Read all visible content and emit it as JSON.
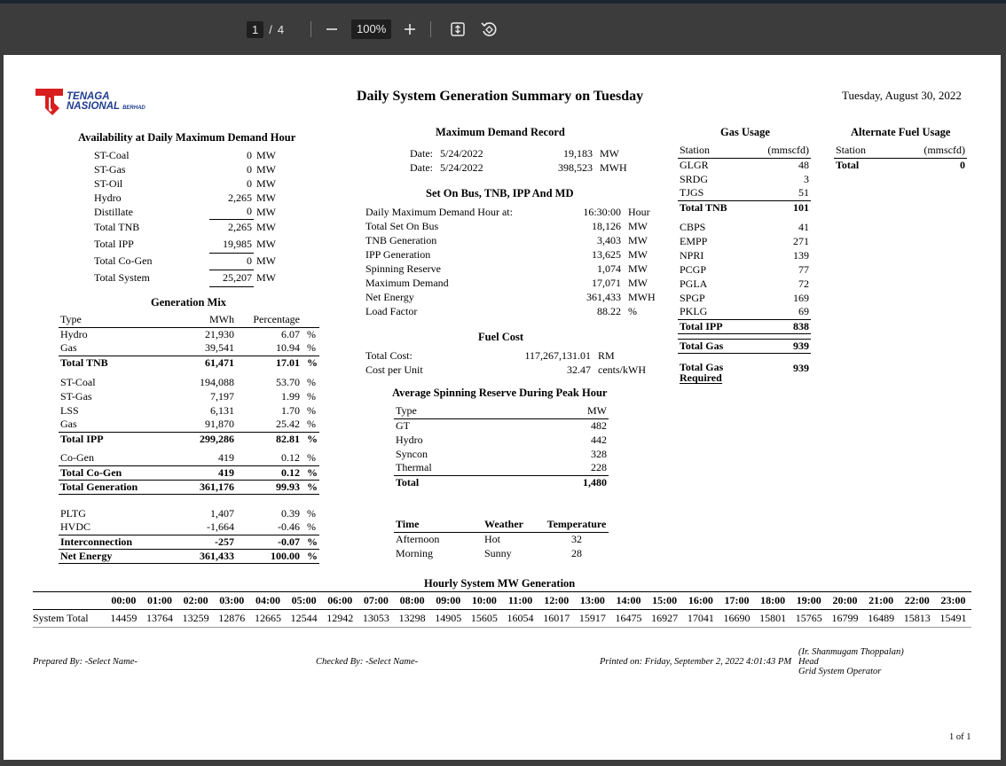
{
  "toolbar": {
    "current_page": "1",
    "page_sep": "/",
    "total_pages": "4",
    "zoom": "100%"
  },
  "header": {
    "logo_line1": "TENAGA",
    "logo_line2": "NASIONAL",
    "logo_line3": "BERHAD",
    "title": "Daily System Generation Summary on Tuesday",
    "date": "Tuesday, August 30, 2022"
  },
  "availability": {
    "title": "Availability at Daily Maximum Demand Hour",
    "rows": [
      {
        "label": "ST-Coal",
        "value": "0",
        "unit": "MW"
      },
      {
        "label": "ST-Gas",
        "value": "0",
        "unit": "MW"
      },
      {
        "label": "ST-Oil",
        "value": "0",
        "unit": "MW"
      },
      {
        "label": "Hydro",
        "value": "2,265",
        "unit": "MW"
      },
      {
        "label": "Distillate",
        "value": "0",
        "unit": "MW"
      },
      {
        "label": "Total TNB",
        "value": "2,265",
        "unit": "MW"
      },
      {
        "label": "Total IPP",
        "value": "19,985",
        "unit": "MW"
      },
      {
        "label": "Total Co-Gen",
        "value": "0",
        "unit": "MW"
      },
      {
        "label": "Total System",
        "value": "25,207",
        "unit": "MW"
      }
    ]
  },
  "generation_mix": {
    "title": "Generation Mix",
    "headers": [
      "Type",
      "MWh",
      "Percentage"
    ],
    "rows": [
      [
        "Hydro",
        "21,930",
        "6.07",
        "%"
      ],
      [
        "Gas",
        "39,541",
        "10.94",
        "%"
      ],
      [
        "Total TNB",
        "61,471",
        "17.01",
        "%"
      ],
      [
        "ST-Coal",
        "194,088",
        "53.70",
        "%"
      ],
      [
        "ST-Gas",
        "7,197",
        "1.99",
        "%"
      ],
      [
        "LSS",
        "6,131",
        "1.70",
        "%"
      ],
      [
        "Gas",
        "91,870",
        "25.42",
        "%"
      ],
      [
        "Total IPP",
        "299,286",
        "82.81",
        "%"
      ],
      [
        "Co-Gen",
        "419",
        "0.12",
        "%"
      ],
      [
        "Total Co-Gen",
        "419",
        "0.12",
        "%"
      ],
      [
        "Total Generation",
        "361,176",
        "99.93",
        "%"
      ],
      [
        "PLTG",
        "1,407",
        "0.39",
        "%"
      ],
      [
        "HVDC",
        "-1,664",
        "-0.46",
        "%"
      ],
      [
        "Interconnection",
        "-257",
        "-0.07",
        "%"
      ],
      [
        "Net Energy",
        "361,433",
        "100.00",
        "%"
      ]
    ]
  },
  "max_demand": {
    "title": "Maximum Demand Record",
    "rows": [
      {
        "label": "Date:",
        "date": "5/24/2022",
        "value": "19,183",
        "unit": "MW"
      },
      {
        "label": "Date:",
        "date": "5/24/2022",
        "value": "398,523",
        "unit": "MWH"
      }
    ]
  },
  "set_on_bus": {
    "title": "Set On Bus, TNB, IPP And MD",
    "rows": [
      {
        "label": "Daily Maximum Demand Hour at:",
        "value": "16:30:00",
        "unit": "Hour"
      },
      {
        "label": "Total Set On Bus",
        "value": "18,126",
        "unit": "MW"
      },
      {
        "label": "TNB Generation",
        "value": "3,403",
        "unit": "MW"
      },
      {
        "label": "IPP Generation",
        "value": "13,625",
        "unit": "MW"
      },
      {
        "label": "Spinning Reserve",
        "value": "1,074",
        "unit": "MW"
      },
      {
        "label": "Maximum Demand",
        "value": "17,071",
        "unit": "MW"
      },
      {
        "label": "Net Energy",
        "value": "361,433",
        "unit": "MWH"
      },
      {
        "label": "Load Factor",
        "value": "88.22",
        "unit": "%"
      }
    ]
  },
  "fuel_cost": {
    "title": "Fuel Cost",
    "rows": [
      {
        "label": "Total Cost:",
        "value": "117,267,131.01",
        "unit": "RM"
      },
      {
        "label": "Cost per Unit",
        "value": "32.47",
        "unit": "cents/kWH"
      }
    ]
  },
  "spinning_reserve": {
    "title": "Average Spinning Reserve During Peak Hour",
    "headers": [
      "Type",
      "MW"
    ],
    "rows": [
      [
        "GT",
        "482"
      ],
      [
        "Hydro",
        "442"
      ],
      [
        "Syncon",
        "328"
      ],
      [
        "Thermal",
        "228"
      ],
      [
        "Total",
        "1,480"
      ]
    ]
  },
  "weather": {
    "headers": [
      "Time",
      "Weather",
      "Temperature"
    ],
    "rows": [
      [
        "Afternoon",
        "Hot",
        "32"
      ],
      [
        "Morning",
        "Sunny",
        "28"
      ]
    ]
  },
  "gas_usage": {
    "title": "Gas Usage",
    "headers": [
      "Station",
      "(mmscfd)"
    ],
    "tnb_rows": [
      [
        "GLGR",
        "48"
      ],
      [
        "SRDG",
        "3"
      ],
      [
        "TJGS",
        "51"
      ]
    ],
    "total_tnb": [
      "Total TNB",
      "101"
    ],
    "ipp_rows": [
      [
        "CBPS",
        "41"
      ],
      [
        "EMPP",
        "271"
      ],
      [
        "NPRI",
        "139"
      ],
      [
        "PCGP",
        "77"
      ],
      [
        "PGLA",
        "72"
      ],
      [
        "SPGP",
        "169"
      ],
      [
        "PKLG",
        "69"
      ]
    ],
    "total_ipp": [
      "Total IPP",
      "838"
    ],
    "total_gas": [
      "Total Gas",
      "939"
    ],
    "total_gas_required_1": "Total Gas",
    "total_gas_required_2": "Required",
    "total_gas_required_value": "939"
  },
  "alt_fuel": {
    "title": "Alternate Fuel Usage",
    "headers": [
      "Station",
      "(mmscfd)"
    ],
    "total": [
      "Total",
      "0"
    ]
  },
  "hourly": {
    "title": "Hourly System MW Generation",
    "hours": [
      "00:00",
      "01:00",
      "02:00",
      "03:00",
      "04:00",
      "05:00",
      "06:00",
      "07:00",
      "08:00",
      "09:00",
      "10:00",
      "11:00",
      "12:00",
      "13:00",
      "14:00",
      "15:00",
      "16:00",
      "17:00",
      "18:00",
      "19:00",
      "20:00",
      "21:00",
      "22:00",
      "23:00"
    ],
    "row_label": "System Total",
    "values": [
      "14459",
      "13764",
      "13259",
      "12876",
      "12665",
      "12544",
      "12942",
      "13053",
      "13298",
      "14905",
      "15605",
      "16054",
      "16017",
      "15917",
      "16475",
      "16927",
      "17041",
      "16690",
      "15801",
      "15765",
      "16799",
      "16489",
      "15813",
      "15491"
    ]
  },
  "footer": {
    "prepared": "Prepared By: -Select Name-",
    "checked": "Checked By: -Select Name-",
    "printed": "Printed on: Friday, September 2, 2022 4:01:43 PM",
    "signer": "(Ir. Shanmugam Thoppalan)",
    "signer_role1": "Head",
    "signer_role2": "Grid System Operator",
    "page": "1 of 1"
  }
}
